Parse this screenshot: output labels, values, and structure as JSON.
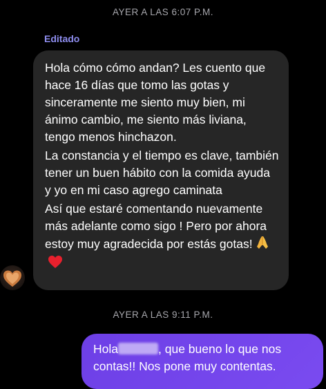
{
  "timestamps": {
    "first": "AYER A LAS 6:07 P.M.",
    "second": "AYER A LAS 9:11 P.M."
  },
  "incoming": {
    "edited_label": "Editado",
    "paragraphs": [
      "Hola cómo cómo andan? Les cuento que  hace 16 días que tomo las gotas y sinceramente me siento muy bien, mi ánimo cambio, me siento más liviana, tengo menos hinchazon.",
      "La constancia y el tiempo es clave, también tener un buen hábito  con la comida ayuda  y yo en mi caso agrego caminata",
      "Así que estaré comentando nuevamente más adelante como sigo ! Pero por ahora estoy muy agradecida por estás gotas!"
    ],
    "emojis": [
      "folded-hands-emoji",
      "red-heart-emoji"
    ]
  },
  "outgoing": {
    "text_before": "Hola",
    "text_after": ", que bueno lo que nos contas!! Nos pone muy contentas."
  },
  "colors": {
    "background": "#000000",
    "incoming_bubble": "#262626",
    "outgoing_bubble": "#7044ea",
    "edited": "#8f8ef0",
    "timestamp": "#a7a7ad"
  }
}
